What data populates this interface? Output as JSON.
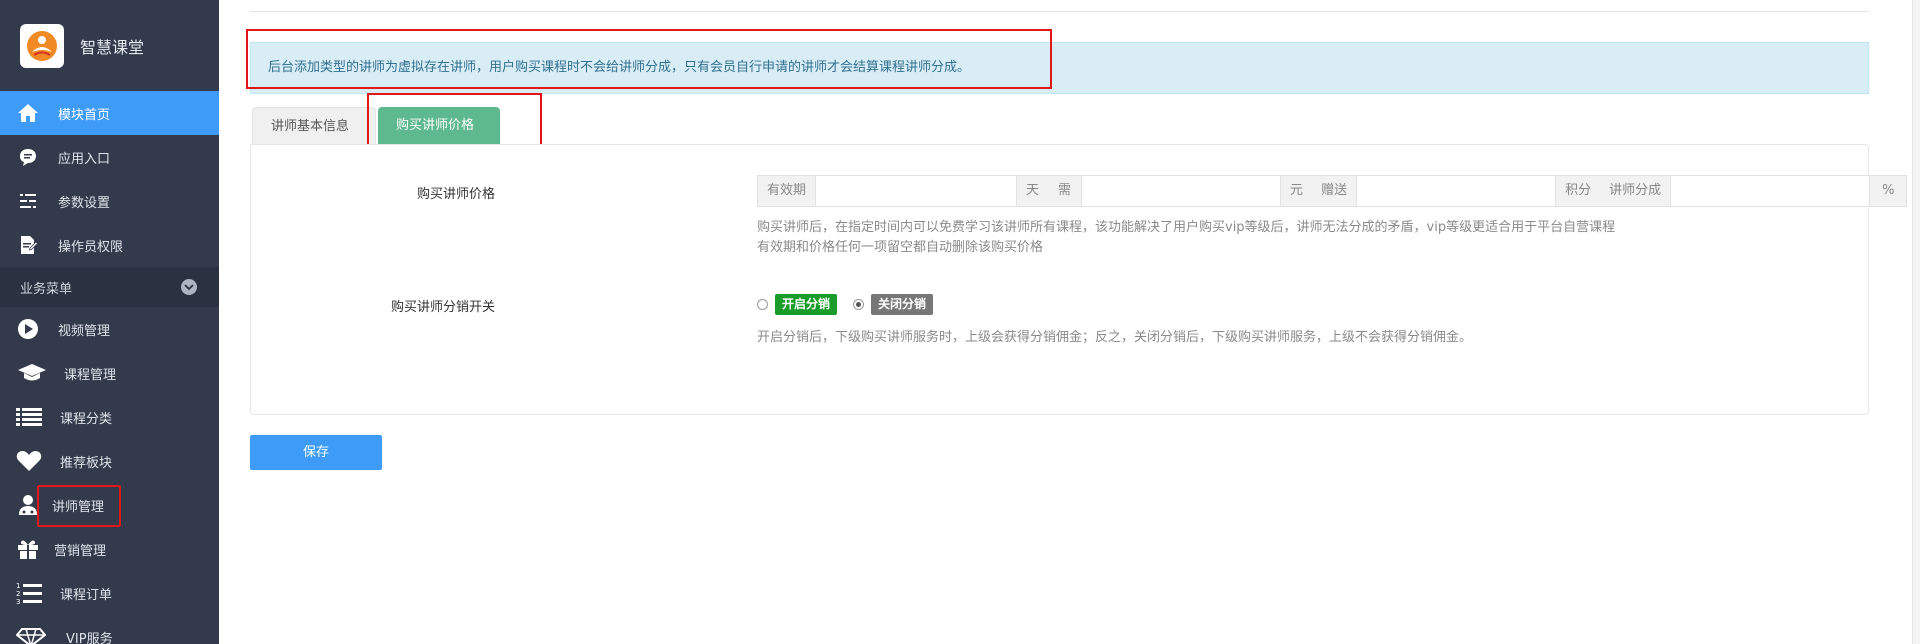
{
  "app": {
    "name": "智慧课堂"
  },
  "sidebar": {
    "items": [
      {
        "label": "模块首页",
        "icon": "home-icon",
        "active": true
      },
      {
        "label": "应用入口",
        "icon": "chat-bubble-icon"
      },
      {
        "label": "参数设置",
        "icon": "settings-list-icon"
      },
      {
        "label": "操作员权限",
        "icon": "document-edit-icon"
      }
    ],
    "group": {
      "label": "业务菜单",
      "icon": "chevron-down-icon"
    },
    "business_items": [
      {
        "label": "视频管理",
        "icon": "play-icon"
      },
      {
        "label": "课程管理",
        "icon": "graduation-cap-icon"
      },
      {
        "label": "课程分类",
        "icon": "list-icon"
      },
      {
        "label": "推荐板块",
        "icon": "heart-icon"
      },
      {
        "label": "讲师管理",
        "icon": "teacher-icon"
      },
      {
        "label": "营销管理",
        "icon": "gift-icon"
      },
      {
        "label": "课程订单",
        "icon": "ordered-list-icon"
      },
      {
        "label": "VIP服务",
        "icon": "vip-diamond-icon"
      }
    ]
  },
  "alert": {
    "text": "后台添加类型的讲师为虚拟存在讲师，用户购买课程时不会给讲师分成，只有会员自行申请的讲师才会结算课程讲师分成。"
  },
  "tabs": [
    {
      "label": "讲师基本信息",
      "active": false
    },
    {
      "label": "购买讲师价格",
      "active": true
    }
  ],
  "price_row": {
    "label": "购买讲师价格",
    "addons": {
      "validity": "有效期",
      "day": "天",
      "need": "需",
      "yuan": "元",
      "gift": "赠送",
      "points": "积分",
      "share": "讲师分成",
      "percent": "%"
    },
    "values": {
      "validity": "",
      "price": "",
      "points": "",
      "share": ""
    },
    "help_line1": "购买讲师后，在指定时间内可以免费学习该讲师所有课程，该功能解决了用户购买vip等级后，讲师无法分成的矛盾，vip等级更适合用于平台自营课程",
    "help_line2": "有效期和价格任何一项留空都自动删除该购买价格"
  },
  "distribution_row": {
    "label": "购买讲师分销开关",
    "options": [
      {
        "label": "开启分销",
        "checked": false,
        "color": "#1a9c2a"
      },
      {
        "label": "关闭分销",
        "checked": true,
        "color": "#777777"
      }
    ],
    "help": "开启分销后，下级购买讲师服务时，上级会获得分销佣金；反之，关闭分销后，下级购买讲师服务，上级不会获得分销佣金。"
  },
  "save_button": {
    "label": "保存"
  },
  "colors": {
    "accent": "#3e9bf7",
    "tab_active": "#5fb98e",
    "sidebar_bg": "#323a4b",
    "highlight": "#e21818"
  }
}
